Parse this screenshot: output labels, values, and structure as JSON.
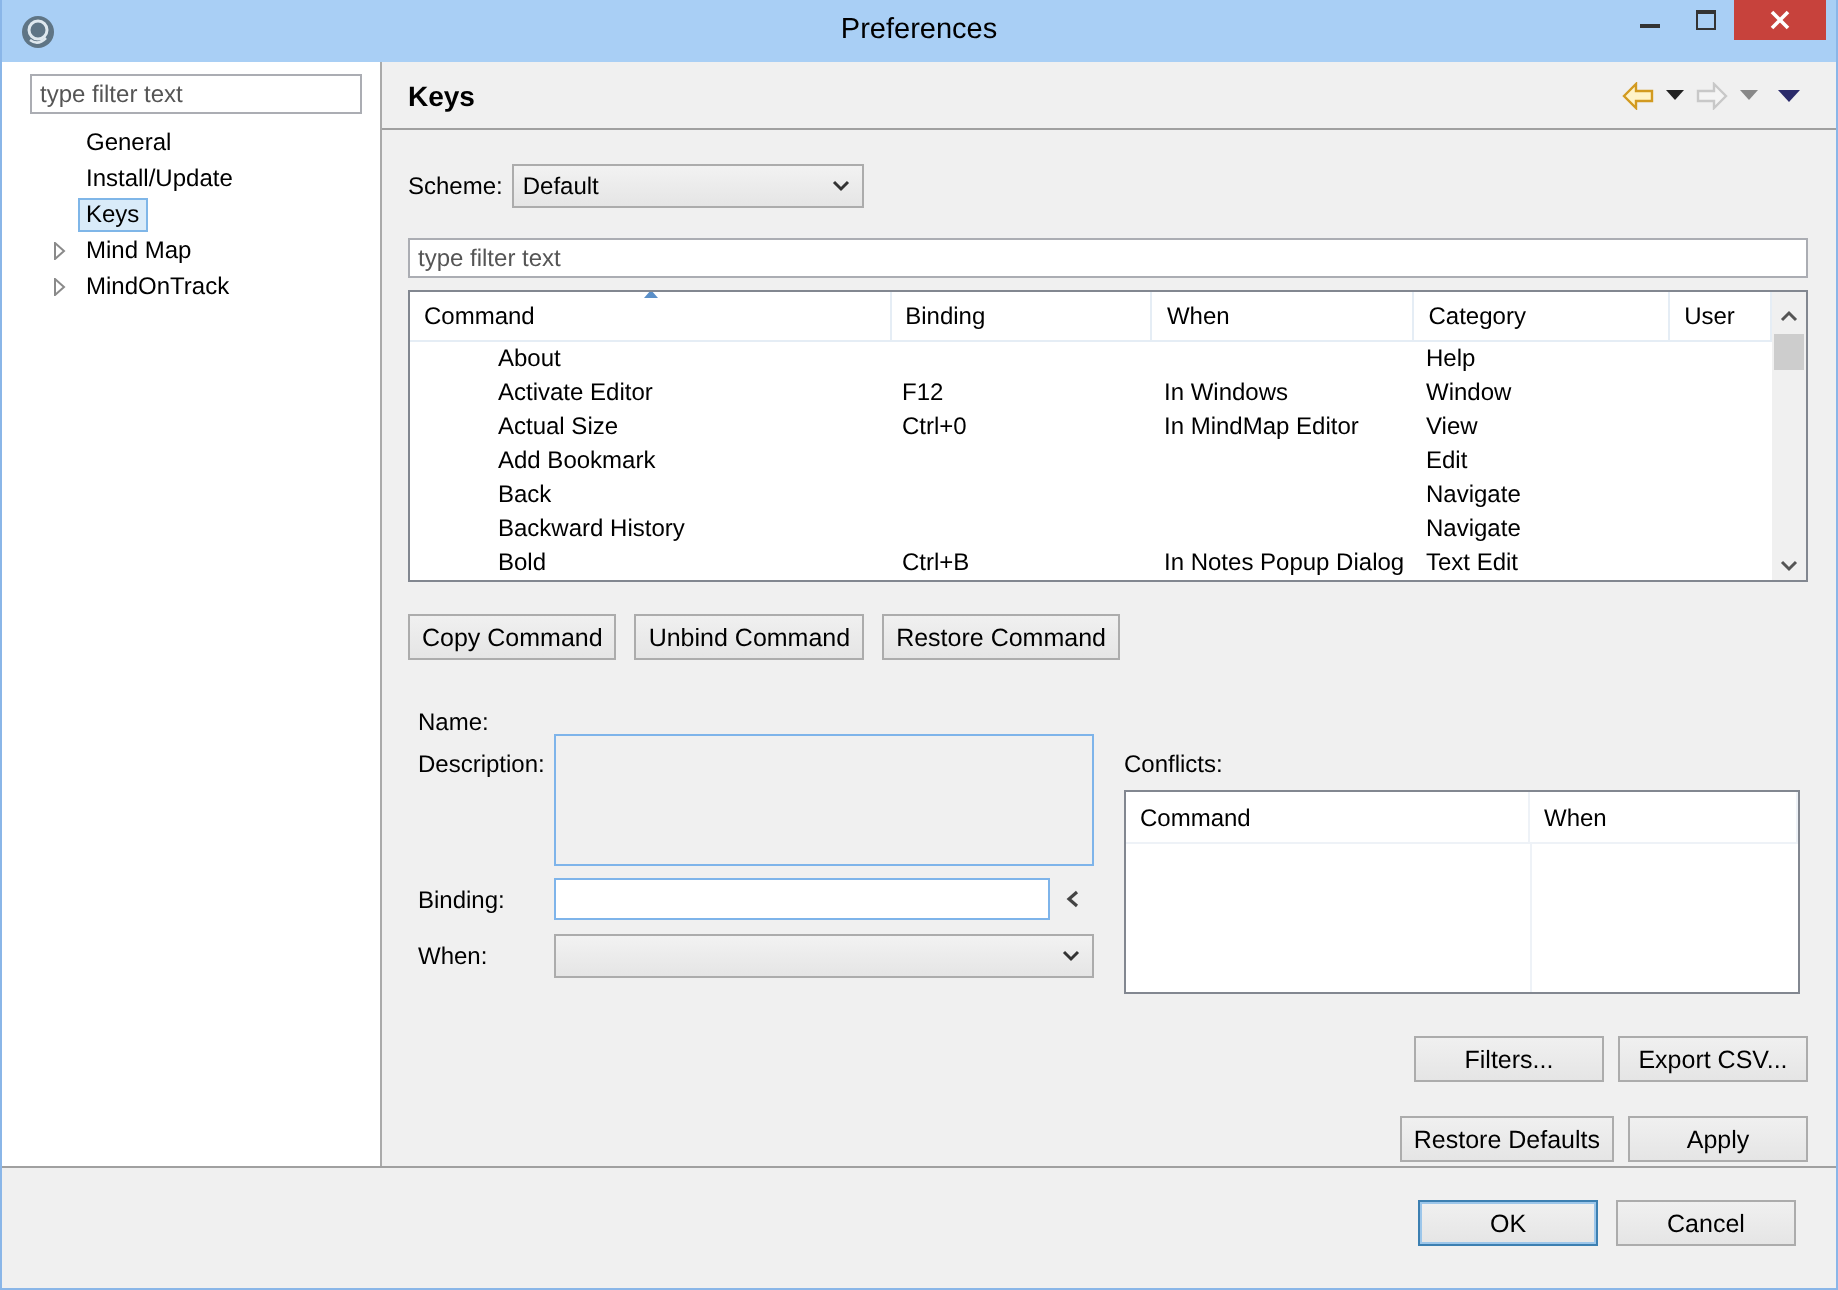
{
  "window": {
    "title": "Preferences"
  },
  "sidebar": {
    "filter": {
      "placeholder": "type filter text"
    },
    "items": [
      {
        "label": "General",
        "selected": false,
        "expandable": false
      },
      {
        "label": "Install/Update",
        "selected": false,
        "expandable": false
      },
      {
        "label": "Keys",
        "selected": true,
        "expandable": false
      },
      {
        "label": "Mind Map",
        "selected": false,
        "expandable": true
      },
      {
        "label": "MindOnTrack",
        "selected": false,
        "expandable": true
      }
    ]
  },
  "page": {
    "title": "Keys",
    "history_buttons": [
      {
        "kind": "back",
        "disabled": false
      },
      {
        "kind": "forward",
        "disabled": true
      }
    ],
    "scheme": {
      "label": "Scheme:",
      "value": "Default"
    },
    "filter": {
      "placeholder": "type filter text"
    },
    "table": {
      "columns": [
        {
          "label": "Command",
          "sorted": true
        },
        {
          "label": "Binding",
          "sorted": false
        },
        {
          "label": "When",
          "sorted": false
        },
        {
          "label": "Category",
          "sorted": false
        },
        {
          "label": "User",
          "sorted": false
        }
      ],
      "rows": [
        {
          "command": "About",
          "category": "Help"
        },
        {
          "command": "Activate Editor",
          "binding": "F12",
          "when": "In Windows",
          "category": "Window"
        },
        {
          "command": "Actual Size",
          "binding": "Ctrl+0",
          "when": "In MindMap Editor",
          "category": "View"
        },
        {
          "command": "Add Bookmark",
          "category": "Edit"
        },
        {
          "command": "Back",
          "category": "Navigate"
        },
        {
          "command": "Backward History",
          "category": "Navigate"
        },
        {
          "command": "Bold",
          "binding": "Ctrl+B",
          "when": "In Notes Popup Dialog",
          "category": "Text Edit"
        }
      ]
    },
    "command_buttons": [
      "Copy Command",
      "Unbind Command",
      "Restore Command"
    ],
    "details": {
      "name_label": "Name:",
      "description_label": "Description:",
      "binding_label": "Binding:",
      "when_label": "When:"
    },
    "conflicts": {
      "label": "Conflicts:",
      "columns": [
        "Command",
        "When"
      ]
    },
    "table_buttons": [
      "Filters...",
      "Export CSV..."
    ],
    "page_buttons": [
      "Restore Defaults",
      "Apply"
    ]
  },
  "footer": {
    "buttons": [
      {
        "label": "OK",
        "default": true
      },
      {
        "label": "Cancel",
        "default": false
      }
    ]
  }
}
